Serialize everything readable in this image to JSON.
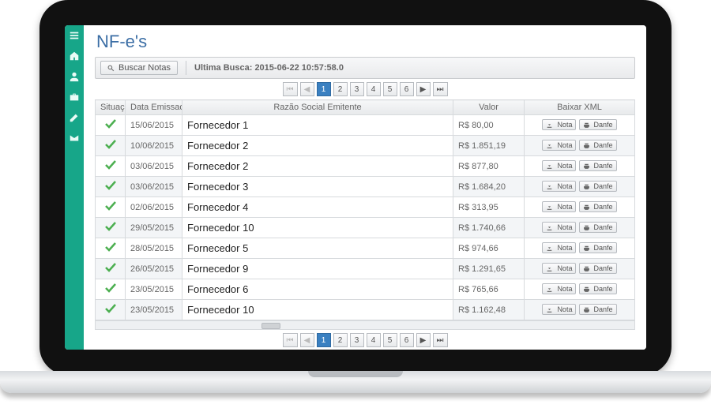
{
  "page": {
    "title": "NF-e's"
  },
  "toolbar": {
    "search_label": "Buscar Notas",
    "last_search_label": "Ultima Busca: 2015-06-22 10:57:58.0"
  },
  "pager": {
    "pages": [
      "1",
      "2",
      "3",
      "4",
      "5",
      "6"
    ],
    "current": "1",
    "first_icon": "first",
    "prev_icon": "prev",
    "next_icon": "next",
    "last_icon": "last"
  },
  "grid": {
    "headers": {
      "situacao": "Situação",
      "data_emissao": "Data Emissao",
      "razao_social": "Razão Social Emitente",
      "valor": "Valor",
      "baixar_xml": "Baixar XML"
    },
    "row_buttons": {
      "nota": "Nota",
      "danfe": "Danfe"
    },
    "rows": [
      {
        "data_emissao": "15/06/2015",
        "razao_social": "Fornecedor 1",
        "valor": "R$ 80,00"
      },
      {
        "data_emissao": "10/06/2015",
        "razao_social": "Fornecedor 2",
        "valor": "R$ 1.851,19"
      },
      {
        "data_emissao": "03/06/2015",
        "razao_social": "Fornecedor 2",
        "valor": "R$ 877,80"
      },
      {
        "data_emissao": "03/06/2015",
        "razao_social": "Fornecedor 3",
        "valor": "R$ 1.684,20"
      },
      {
        "data_emissao": "02/06/2015",
        "razao_social": "Fornecedor 4",
        "valor": "R$ 313,95"
      },
      {
        "data_emissao": "29/05/2015",
        "razao_social": "Fornecedor 10",
        "valor": "R$ 1.740,66"
      },
      {
        "data_emissao": "28/05/2015",
        "razao_social": "Fornecedor 5",
        "valor": "R$ 974,66"
      },
      {
        "data_emissao": "26/05/2015",
        "razao_social": "Fornecedor 9",
        "valor": "R$ 1.291,65"
      },
      {
        "data_emissao": "23/05/2015",
        "razao_social": "Fornecedor 6",
        "valor": "R$ 765,66"
      },
      {
        "data_emissao": "23/05/2015",
        "razao_social": "Fornecedor 10",
        "valor": "R$ 1.162,48"
      }
    ]
  },
  "sidebar": {
    "icons": [
      "menu",
      "home",
      "user",
      "briefcase",
      "pencil",
      "mail"
    ]
  }
}
